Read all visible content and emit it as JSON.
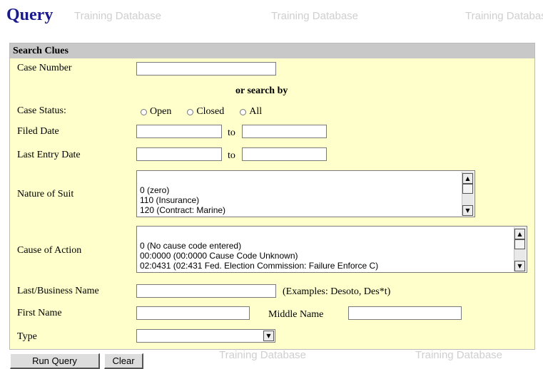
{
  "page": {
    "title": "Query",
    "watermark": "Training Database"
  },
  "search_clues": {
    "header": "Search Clues",
    "case_number_label": "Case Number",
    "case_number_value": "",
    "or_search_by": "or search by",
    "case_status_label": "Case Status:",
    "case_status_options": [
      "Open",
      "Closed",
      "All"
    ],
    "filed_date_label": "Filed Date",
    "filed_date_to": "to",
    "last_entry_date_label": "Last Entry Date",
    "last_entry_date_to": "to",
    "nature_of_suit_label": "Nature of Suit",
    "nature_of_suit_options": [
      "0 (zero)",
      "110 (Insurance)",
      "120 (Contract: Marine)"
    ],
    "cause_of_action_label": "Cause of Action",
    "cause_of_action_options": [
      "0 (No cause code entered)",
      "00:0000 (00:0000 Cause Code Unknown)",
      "02:0431 (02:431 Fed. Election Commission: Failure Enforce C)"
    ],
    "last_business_name_label": "Last/Business Name",
    "last_business_name_examples": "(Examples: Desoto, Des*t)",
    "first_name_label": "First Name",
    "middle_name_label": "Middle Name",
    "type_label": "Type",
    "type_value": ""
  },
  "actions": {
    "run_query": "Run Query",
    "clear": "Clear"
  }
}
